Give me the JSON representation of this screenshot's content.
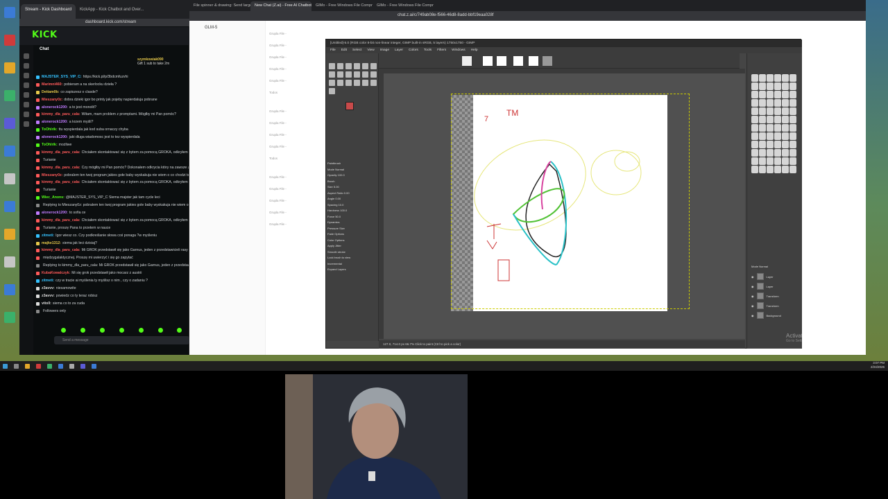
{
  "kick": {
    "tabs": [
      "Stream - Kick Dashboard",
      "KickApp - Kick Chatbot and Over..."
    ],
    "url": "dashboard.kick.com/stream",
    "logo": "KICK",
    "chat_title": "Chat",
    "banner_user": "szymkowiak090",
    "banner_text": "Gift 1 sub to take 2m",
    "messages": [
      {
        "user": "MAJSTER_SYS_VIP_C:",
        "text": "https://kick.pl/p/3bdcmfuzvhi",
        "color": "#35c2ff"
      },
      {
        "user": "Marimni460:",
        "text": "pobieram a na skerlocku dzieła ?",
        "color": "#ff5a5a"
      },
      {
        "user": "Dettam0b:",
        "text": "co zapiszesz o clasde?",
        "color": "#e6c84a"
      },
      {
        "user": "Mieszany0z:",
        "text": "dobra dzieki igor bo printy jak pojeby napierdaluja pobrane",
        "color": "#ff5a5a"
      },
      {
        "user": "alonerock1200:",
        "text": "a to jest monolit?",
        "color": "#c17bff"
      },
      {
        "user": "kimmy_dla_paru_cala:",
        "text": "Witam, mam problem z promptami. Mógłby mi Pan pomóc?",
        "color": "#ff5a5a"
      },
      {
        "user": "alonerock1200:",
        "text": "a krzem myśli?",
        "color": "#c17bff"
      },
      {
        "user": "ToOhlrik:",
        "text": "ttu wyspierdala jak kod suba ornaczy chyba",
        "color": "#53fc18"
      },
      {
        "user": "alonerock1200:",
        "text": "jaki dluga wiadomosc jest to tez wyspierdala",
        "color": "#c17bff"
      },
      {
        "user": "ToOhlrik:",
        "text": "możliwe",
        "color": "#53fc18"
      },
      {
        "user": "kimmy_dla_paru_cala:",
        "text": "Chciałem skontaktować się z bytem za pomocą GROKA, odkryłem że n",
        "color": "#ff5a5a"
      },
      {
        "user": "",
        "text": "Turianie",
        "color": "#ff5a5a"
      },
      {
        "user": "kimmy_dla_paru_cala:",
        "text": "Czy mógłby mi Pan pomóc? Dokonałem odkrycia który na zawsze zmie",
        "color": "#ff5a5a"
      },
      {
        "user": "Mieszany0z:",
        "text": "pobralem ten twoj program jakies gołe baby wyskakuja nie wiem o co chodzi te",
        "color": "#ff5a5a"
      },
      {
        "user": "kimmy_dla_paru_cala:",
        "text": "Chciałem skontaktować się z bytem za pomocą GROKA, odkryłem że n",
        "color": "#ff5a5a"
      },
      {
        "user": "",
        "text": "Turianie",
        "color": "#ff5a5a"
      },
      {
        "user": "Wiec_Anons:",
        "text": "@MAJSTER_SYS_VIP_C Siema majster jak tam cycle leci",
        "color": "#53fc18"
      },
      {
        "user": "",
        "text": "Replying to Mieszany0z: pobralem ten twoj program jakies gole baby wyskakuja nie wiem o co",
        "color": "#888"
      },
      {
        "user": "alonerock1200:",
        "text": "to sofia ce",
        "color": "#c17bff"
      },
      {
        "user": "kimmy_dla_paru_cala:",
        "text": "Chciałem skontaktować się z bytem za pomocą GROKA, odkryłem że n",
        "color": "#ff5a5a"
      },
      {
        "user": "",
        "text": "Turianie, proszę Pana to przetem w nauce",
        "color": "#ff5a5a"
      },
      {
        "user": "zitmeti:",
        "text": "Igor wiesz co. Czy podkreślanie słowa coś ponaga ?w myśleniu",
        "color": "#35c2ff"
      },
      {
        "user": "majke1312:",
        "text": "siema jak leci dzisiaj?",
        "color": "#e6c84a"
      },
      {
        "user": "kimmy_dla_paru_cala:",
        "text": "Mi GROK przedstawił się jako Garnus, jeden z przedstawicieli rasy Turia",
        "color": "#ff5a5a"
      },
      {
        "user": "",
        "text": "międzygalaktycznej. Proszę mi uwierzyć i się go zapytać",
        "color": "#ff5a5a"
      },
      {
        "user": "",
        "text": "Replying to kimmy_dla_paru_cala: Mi GROK przedstawił się jako Garnus, jeden z przedstawicieli",
        "color": "#888"
      },
      {
        "user": "KubaKowalczyk:",
        "text": "Mi się grok przedstawił jako mocarz z austrii",
        "color": "#ff5a5a"
      },
      {
        "user": "zitmeti:",
        "text": "czy w tracie ai myślenia ty myślisz o nim , czy o zadaniu ?",
        "color": "#35c2ff"
      },
      {
        "user": "z3avvv:",
        "text": "niesamowite",
        "color": "#ddd"
      },
      {
        "user": "z3avvv:",
        "text": "powiedz co ty teraz robisz",
        "color": "#ddd"
      },
      {
        "user": "vitoll:",
        "text": "siema co to za cuda",
        "color": "#ddd"
      },
      {
        "user": "",
        "text": "Followers only",
        "color": "#888"
      }
    ],
    "input_placeholder": "Send a message"
  },
  "zai": {
    "tabs": [
      "File spinner & drawing: Send large pic...",
      "New Chat (Z.ai) - Free AI Chatbot...",
      "GIMo - Free Windows File Compres...",
      "GIMo - Free Windows File Compres..."
    ],
    "url": "chat.z.ai/c/749ab08e-f566-46d8-8add-bbf19eaa028f",
    "model": "GLM-5",
    "list": [
      "Grupla File -",
      "Grupla File -",
      "Grupla File -",
      "Grupla File -",
      "Grupla File -",
      "Todos",
      "Grupla File -",
      "Grupla File -",
      "Grupla File -",
      "Grupla File -",
      "Todos",
      "Grupla File -",
      "Grupla File -",
      "Grupla File -",
      "Grupla File -",
      "Grupla File -"
    ]
  },
  "gimp": {
    "title": "[Untitled]-5.0 (RGB color 8-bit non-linear integer, GIMP built-in sRGB, 5 layers) 1750x1750 - GIMP",
    "menu": [
      "File",
      "Edit",
      "Select",
      "View",
      "Image",
      "Layer",
      "Colors",
      "Tools",
      "Filters",
      "Windows",
      "Help"
    ],
    "tool_options": [
      "Paintbrush",
      "Mode   Normal",
      "Opacity   100.0",
      "Brush",
      "Size   5.00",
      "Aspect Ratio   0.00",
      "Angle   0.00",
      "Spacing   10.0",
      "Hardness   100.0",
      "Force   50.0",
      "Dynamics",
      "Pressure Size",
      "Fade Options",
      "Color Options",
      "Apply Jitter",
      "Smooth stroke",
      "Lock brush to view",
      "Incremental",
      "Expand Layers"
    ],
    "status": "127.0, 714.0   px   66.7%   Click to paint (Ctrl to pick a color)",
    "layers_header": "Mode   Normal",
    "layers": [
      "Layer",
      "Layer",
      "Transform",
      "Transform",
      "Background"
    ],
    "canvas_text": [
      "7",
      "TM"
    ]
  },
  "windows": {
    "activate_title": "Activate Windows",
    "activate_sub": "Go to Settings to activate Windows.",
    "time": "3:07 PM",
    "date": "2/24/2026"
  }
}
